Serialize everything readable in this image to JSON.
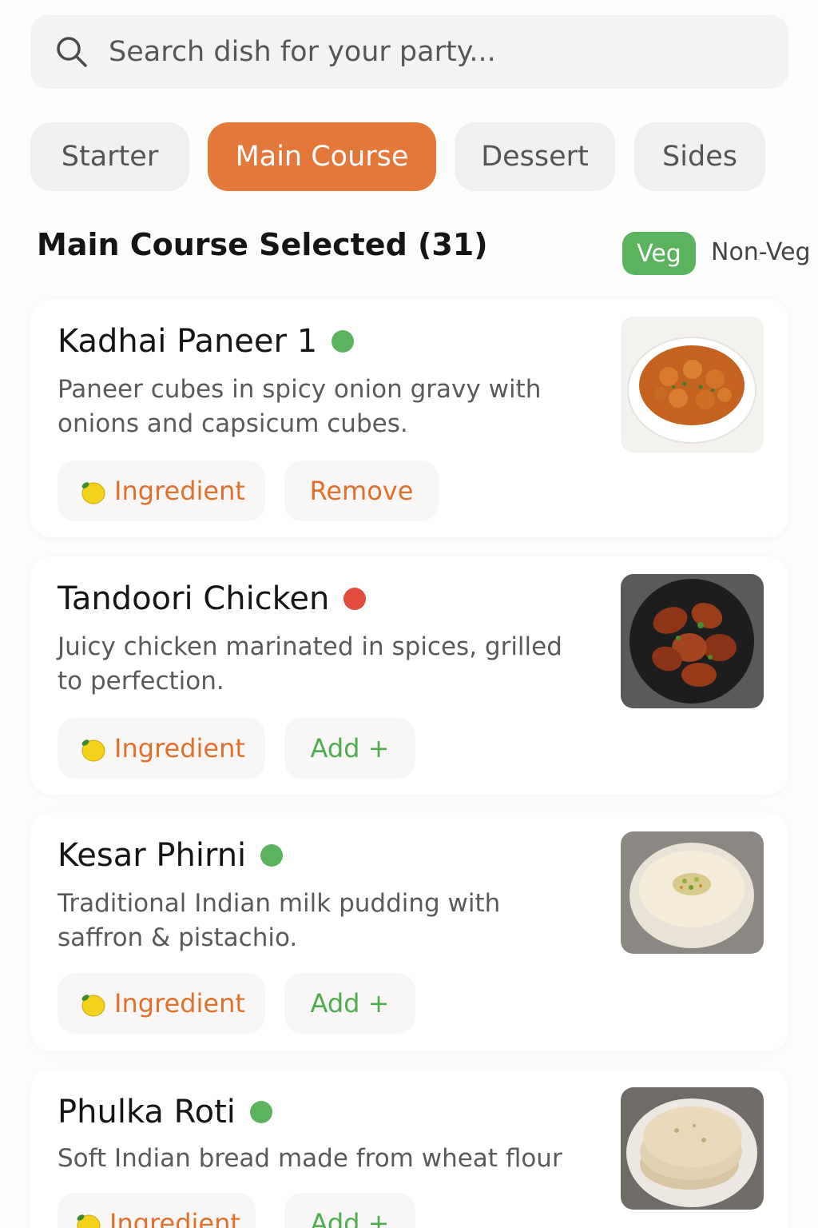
{
  "search": {
    "placeholder": "Search dish for your party..."
  },
  "tabs": [
    {
      "label": "Starter",
      "active": false
    },
    {
      "label": "Main Course",
      "active": true
    },
    {
      "label": "Dessert",
      "active": false
    },
    {
      "label": "Sides",
      "active": false
    }
  ],
  "section": {
    "title": "Main Course Selected (31)"
  },
  "filter": {
    "veg_label": "Veg",
    "nonveg_label": "Non-Veg",
    "selected": "Veg"
  },
  "colors": {
    "accent": "#e4773a",
    "veg": "#5bb35e",
    "nonveg": "#e04b3b"
  },
  "dishes": [
    {
      "name": "Kadhai Paneer 1",
      "type": "veg",
      "description": "Paneer cubes in spicy onion gravy with onions and capsicum cubes.",
      "ingredient_label": "Ingredient",
      "action_label": "Remove",
      "action": "remove",
      "image": "paneer-curry-bowl"
    },
    {
      "name": "Tandoori Chicken",
      "type": "non-veg",
      "description": "Juicy chicken marinated in spices, grilled to perfection.",
      "ingredient_label": "Ingredient",
      "action_label": "Add +",
      "action": "add",
      "image": "tandoori-chicken-plate"
    },
    {
      "name": "Kesar Phirni",
      "type": "veg",
      "description": "Traditional Indian milk pudding with saffron & pistachio.",
      "ingredient_label": "Ingredient",
      "action_label": "Add +",
      "action": "add",
      "image": "phirni-bowl"
    },
    {
      "name": "Phulka Roti",
      "type": "veg",
      "description": "Soft Indian bread made from wheat flour",
      "ingredient_label": "Ingredient",
      "action_label": "Add +",
      "action": "add",
      "image": "roti-stack-plate"
    }
  ]
}
